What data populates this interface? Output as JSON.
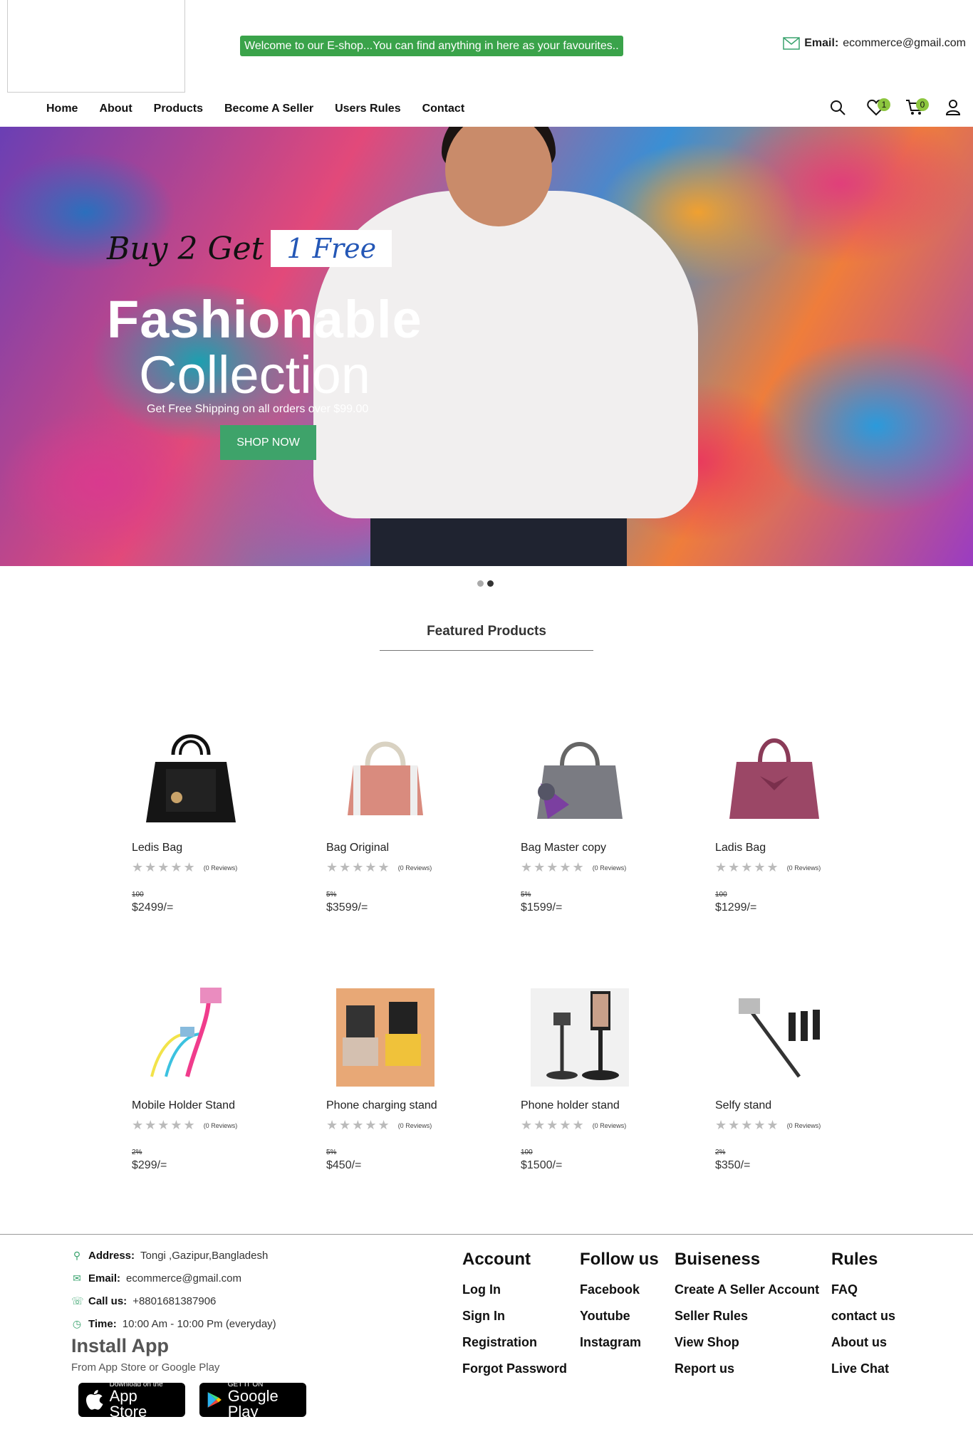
{
  "header": {
    "welcome": "Welcome to our E-shop...You can find anything in here as your favourites..",
    "email_label": "Email:",
    "email_value": "ecommerce@gmail.com"
  },
  "nav": {
    "items": [
      "Home",
      "About",
      "Products",
      "Become A Seller",
      "Users Rules",
      "Contact"
    ],
    "wishlist_count": "1",
    "cart_count": "0"
  },
  "hero": {
    "buy_text": "Buy 2 Get",
    "free_text": "1 Free",
    "title_line1": "Fashionable",
    "title_line2": "Collection",
    "subtitle": "Get Free Shipping on all orders over $99.00",
    "button": "SHOP NOW"
  },
  "featured": {
    "title": "Featured Products",
    "products": [
      {
        "name": "Ledis Bag",
        "reviews": "(0 Reviews)",
        "old": "100",
        "price": "$2499/="
      },
      {
        "name": "Bag Original",
        "reviews": "(0 Reviews)",
        "old": "5%",
        "price": "$3599/="
      },
      {
        "name": "Bag Master copy",
        "reviews": "(0 Reviews)",
        "old": "5%",
        "price": "$1599/="
      },
      {
        "name": "Ladis Bag",
        "reviews": "(0 Reviews)",
        "old": "100",
        "price": "$1299/="
      },
      {
        "name": "Mobile Holder Stand",
        "reviews": "(0 Reviews)",
        "old": "2%",
        "price": "$299/="
      },
      {
        "name": "Phone charging stand",
        "reviews": "(0 Reviews)",
        "old": "5%",
        "price": "$450/="
      },
      {
        "name": "Phone holder stand",
        "reviews": "(0 Reviews)",
        "old": "100",
        "price": "$1500/="
      },
      {
        "name": "Selfy stand",
        "reviews": "(0 Reviews)",
        "old": "2%",
        "price": "$350/="
      }
    ]
  },
  "footer": {
    "address_label": "Address:",
    "address_value": "Tongi ,Gazipur,Bangladesh",
    "email_label": "Email:",
    "email_value": "ecommerce@gmail.com",
    "call_label": "Call us:",
    "call_value": "+8801681387906",
    "time_label": "Time:",
    "time_value": "10:00 Am - 10:00 Pm (everyday)",
    "install_title": "Install App",
    "install_sub": "From App Store or Google Play",
    "appstore_small": "Download on the",
    "appstore_big": "App Store",
    "play_small": "GET IT ON",
    "play_big": "Google Play",
    "columns": [
      {
        "title": "Account",
        "links": [
          "Log In",
          "Sign In",
          "Registration",
          "Forgot Password"
        ]
      },
      {
        "title": "Follow us",
        "links": [
          "Facebook",
          "Youtube",
          "Instagram"
        ]
      },
      {
        "title": "Buiseness",
        "links": [
          "Create A Seller Account",
          "Seller Rules",
          "View Shop",
          "Report us"
        ]
      },
      {
        "title": "Rules",
        "links": [
          "FAQ",
          "contact us",
          "About us",
          "Live Chat"
        ]
      }
    ]
  }
}
